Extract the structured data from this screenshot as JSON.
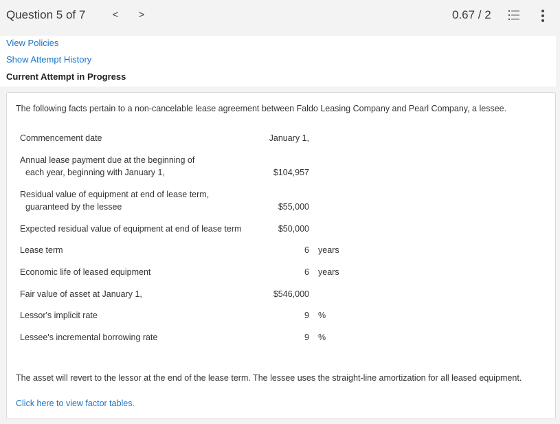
{
  "header": {
    "question_label": "Question 5 of 7",
    "prev_glyph": "<",
    "next_glyph": ">",
    "score": "0.67 / 2"
  },
  "panel": {
    "view_policies": "View Policies",
    "show_attempt_history": "Show Attempt History",
    "current_attempt": "Current Attempt in Progress"
  },
  "problem": {
    "intro": "The following facts pertain to a non-cancelable lease agreement between Faldo Leasing Company and Pearl Company, a lessee.",
    "rows": [
      {
        "label": "Commencement date",
        "label2": "",
        "value": "January 1,",
        "unit": ""
      },
      {
        "label": "Annual lease payment due at the beginning of",
        "label2": "each year, beginning with January 1,",
        "value": "$104,957",
        "unit": ""
      },
      {
        "label": "Residual value of equipment at end of lease term,",
        "label2": "guaranteed by the lessee",
        "value": "$55,000",
        "unit": ""
      },
      {
        "label": "Expected residual value of equipment at end of lease term",
        "label2": "",
        "value": "$50,000",
        "unit": ""
      },
      {
        "label": "Lease term",
        "label2": "",
        "value": "6",
        "unit": "years"
      },
      {
        "label": "Economic life of leased equipment",
        "label2": "",
        "value": "6",
        "unit": "years"
      },
      {
        "label": "Fair value of asset at January 1,",
        "label2": "",
        "value": "$546,000",
        "unit": ""
      },
      {
        "label": "Lessor's implicit rate",
        "label2": "",
        "value": "9",
        "unit": "%"
      },
      {
        "label": "Lessee's incremental borrowing rate",
        "label2": "",
        "value": "9",
        "unit": "%"
      }
    ],
    "closing": "The asset will revert to the lessor at the end of the lease term. The lessee uses the straight-line amortization for all leased equipment.",
    "factor_link": "Click here to view factor tables."
  },
  "colors": {
    "link": "#1a73c7",
    "background": "#f3f3f3",
    "card": "#ffffff"
  },
  "icons": [
    "chevron-left-icon",
    "chevron-right-icon",
    "list-icon",
    "more-vertical-icon"
  ]
}
